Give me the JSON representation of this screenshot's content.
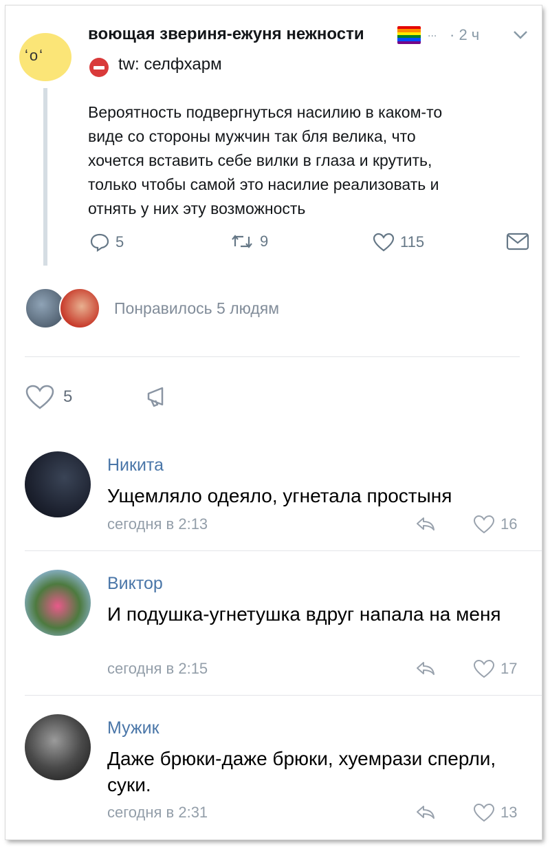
{
  "tweet": {
    "author_name": "воющая звериня-ежуня нежности",
    "flag_colors": [
      "#e40303",
      "#ff8c00",
      "#ffed00",
      "#008026",
      "#004dff",
      "#750787"
    ],
    "more_dots": "...",
    "time": "· 2 ч",
    "tw_tag": "tw: селфхарм",
    "avatar_icon": "cartoon-face-icon",
    "text": "Вероятность подвергнуться насилию в каком-то\nвиде со стороны мужчин так бля велика, что\nхочется вставить себе вилки в глаза и крутить,\nтолько чтобы самой это насилие реализовать и\nотнять у них эту возможность",
    "actions": {
      "replies": "5",
      "retweets": "9",
      "likes": "115"
    }
  },
  "vk_post": {
    "liked_by_text": "Понравилось 5 людям",
    "like_count": "5"
  },
  "comments": [
    {
      "name": "Никита",
      "text": "Ущемляло одеяло, угнетала простыня",
      "time": "сегодня в 2:13",
      "likes": "16"
    },
    {
      "name": "Виктор",
      "text": "И подушка-угнетушка вдруг напала на меня",
      "time": "сегодня в 2:15",
      "likes": "17"
    },
    {
      "name": "Мужик",
      "text": "Даже брюки-даже брюки, хуемрази сперли, суки.",
      "time": "сегодня в 2:31",
      "likes": "13"
    }
  ]
}
